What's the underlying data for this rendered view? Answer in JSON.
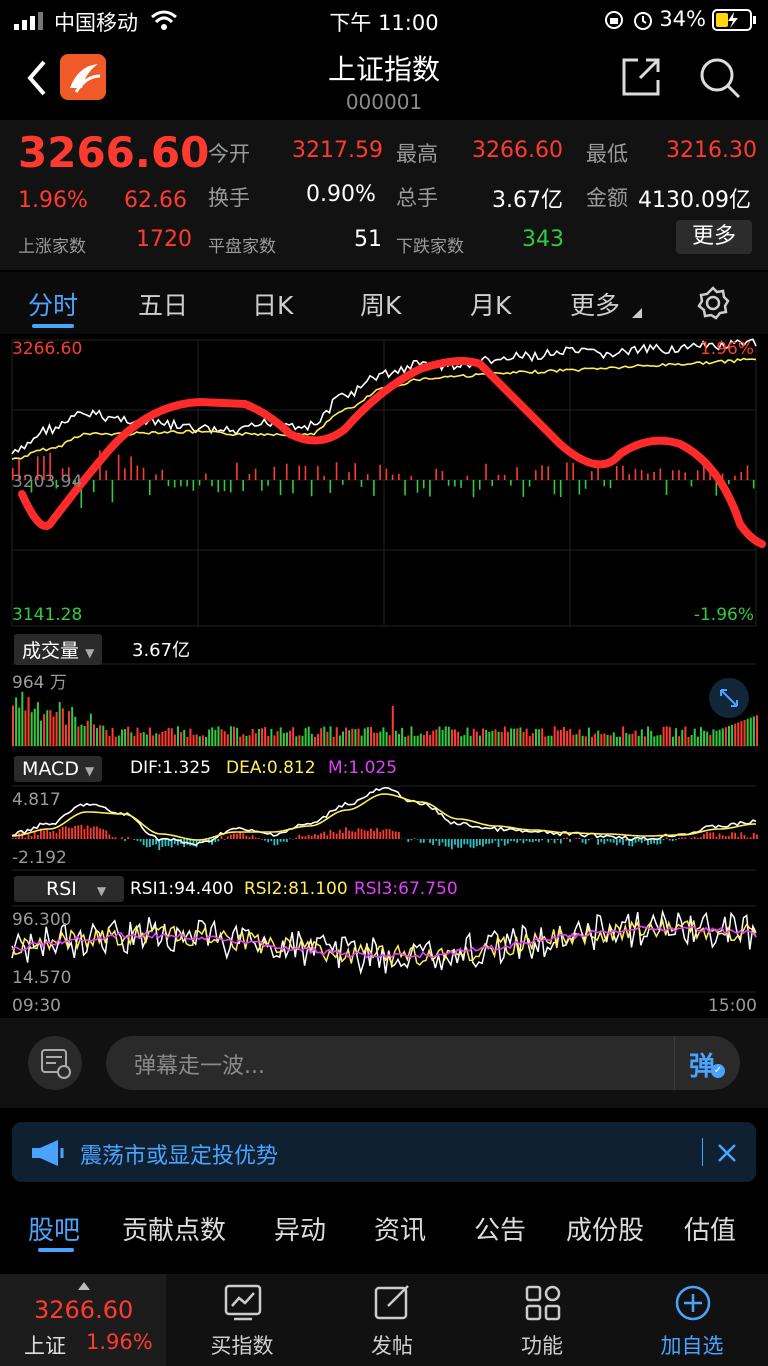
{
  "status": {
    "carrier": "中国移动",
    "time": "下午 11:00",
    "battery": "34%"
  },
  "nav": {
    "title": "上证指数",
    "code": "000001"
  },
  "quote": {
    "price": "3266.60",
    "change_pct": "1.96%",
    "change_abs": "62.66",
    "open_label": "今开",
    "open": "3217.59",
    "high_label": "最高",
    "high": "3266.60",
    "low_label": "最低",
    "low": "3216.30",
    "turnover_label": "换手",
    "turnover": "0.90%",
    "volume_label": "总手",
    "volume": "3.67亿",
    "amount_label": "金额",
    "amount": "4130.09亿",
    "up_label": "上涨家数",
    "up": "1720",
    "flat_label": "平盘家数",
    "flat": "51",
    "down_label": "下跌家数",
    "down": "343",
    "more_button": "更多"
  },
  "tabs": [
    "分时",
    "五日",
    "日K",
    "周K",
    "月K",
    "更多"
  ],
  "chart": {
    "top_price": "3266.60",
    "mid_price": "3203.94",
    "bottom_price": "3141.28",
    "top_pct": "1.96%",
    "bottom_pct": "-1.96%"
  },
  "volume_panel": {
    "selector": "成交量",
    "value": "3.67亿",
    "max": "964 万"
  },
  "macd_panel": {
    "selector": "MACD",
    "dif": "DIF:1.325",
    "dea": "DEA:0.812",
    "m": "M:1.025",
    "top": "4.817",
    "bottom": "-2.192"
  },
  "rsi_panel": {
    "selector": "RSI",
    "rsi1": "RSI1:94.400",
    "rsi2": "RSI2:81.100",
    "rsi3": "RSI3:67.750",
    "top": "96.300",
    "bottom": "14.570"
  },
  "time_axis": {
    "start": "09:30",
    "end": "15:00"
  },
  "danmaku": {
    "placeholder": "弹幕走一波...",
    "button": "弹"
  },
  "notice": {
    "text": "震荡市或显定投优势"
  },
  "bottom_tabs": [
    "股吧",
    "贡献点数",
    "异动",
    "资讯",
    "公告",
    "成份股",
    "估值"
  ],
  "footer": {
    "price": "3266.60",
    "name": "上证",
    "pct": "1.96%",
    "buy": "买指数",
    "post": "发帖",
    "func": "功能",
    "add": "加自选"
  },
  "colors": {
    "up": "#ff3b30",
    "down": "#2ecc40",
    "accent": "#4aa3ff",
    "macd_dea": "#ffee55",
    "rsi3": "#e040fb"
  }
}
